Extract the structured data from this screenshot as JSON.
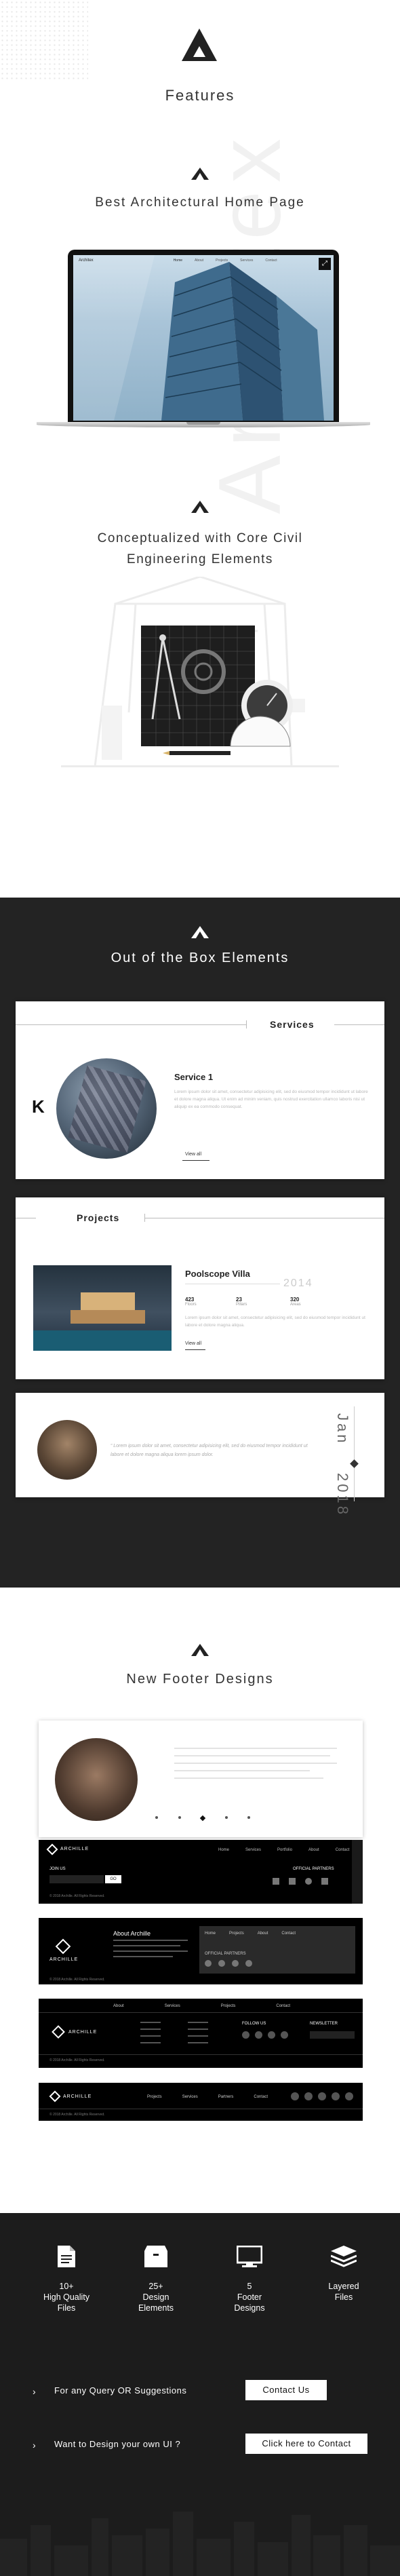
{
  "features": {
    "title": "Features"
  },
  "section_home": {
    "title": "Best Architectural Home Page"
  },
  "laptop": {
    "brand": "Architex",
    "nav": [
      "Home",
      "About",
      "Projects",
      "Services",
      "Contact"
    ]
  },
  "section_civil": {
    "title_line1": "Conceptualized with Core Civil",
    "title_line2": "Engineering Elements"
  },
  "watermark": {
    "text": "Architex"
  },
  "section_elements": {
    "title": "Out of the Box Elements"
  },
  "services_card": {
    "heading": "Services",
    "service_title": "Service 1",
    "body": "Lorem ipsum dolor sit amet, consectetur adipisicing elit, sed do eiusmod tempor incididunt ut labore et dolore magna aliqua. Ut enim ad minim veniam, quis nostrud exercitation ullamco laboris nisi ut aliquip ex ea commodo consequat.",
    "link": "View all"
  },
  "projects_card": {
    "heading": "Projects",
    "project_title": "Poolscope Villa",
    "year": "2014",
    "stats": [
      {
        "value": "423",
        "label": "Floors"
      },
      {
        "value": "23",
        "label": "Pillars"
      },
      {
        "value": "320",
        "label": "Areas"
      }
    ],
    "body": "Lorem ipsum dolor sit amet, consectetur adipisicing elit, sed do eiusmod tempor incididunt ut labore et dolore magna aliqua.",
    "link": "View all"
  },
  "testimonial_card": {
    "quote": "“ Lorem ipsum dolor sit amet, consectetur adipisicing elit, sed do eiusmod tempor incididunt ut labore et dolore magna aliqua lorem ipsum dolor.",
    "month": "Jan",
    "year": "2018"
  },
  "section_footer": {
    "title": "New Footer Designs"
  },
  "footer1": {
    "brand": "ARCHILLE",
    "nav": [
      "Home",
      "Services",
      "Portfolio",
      "About",
      "Contact"
    ],
    "join": "JOIN US",
    "go": "GO",
    "partners": "OFFICIAL PARTNERS",
    "copy": "© 2018 Archille. All Rights Reserved."
  },
  "footer2": {
    "brand": "ARCHILLE",
    "about_title": "About Archille",
    "cols": [
      "Home",
      "Projects",
      "About",
      "Contact"
    ],
    "partners": "OFFICIAL PARTNERS",
    "copy": "© 2018 Archille. All Rights Reserved."
  },
  "footer3": {
    "brand": "ARCHILLE",
    "nav": [
      "About",
      "Services",
      "Projects",
      "Contact"
    ],
    "follow": "FOLLOW US",
    "newsletter": "NEWSLETTER",
    "copy": "© 2018 Archille. All Rights Reserved."
  },
  "footer4": {
    "brand": "ARCHILLE",
    "nav": [
      "Projects",
      "Services",
      "Partners",
      "Contact"
    ],
    "copy": "© 2018 Archille. All Rights Reserved."
  },
  "stats": [
    {
      "icon": "file-icon",
      "line1": "10+",
      "line2": "High Quality",
      "line3": "Files"
    },
    {
      "icon": "box-icon",
      "line1": "25+",
      "line2": "Design",
      "line3": "Elements"
    },
    {
      "icon": "monitor-icon",
      "line1": "5",
      "line2": "Footer",
      "line3": "Designs"
    },
    {
      "icon": "layers-icon",
      "line1": "Layered",
      "line2": "Files",
      "line3": ""
    }
  ],
  "cta": [
    {
      "text": "For any Query OR Suggestions",
      "button": "Contact Us"
    },
    {
      "text": "Want to Design your own UI ?",
      "button": "Click here to Contact"
    }
  ],
  "colors": {
    "dark": "#232323",
    "darker": "#1c1c1c",
    "white": "#ffffff",
    "accent": "#222222"
  }
}
